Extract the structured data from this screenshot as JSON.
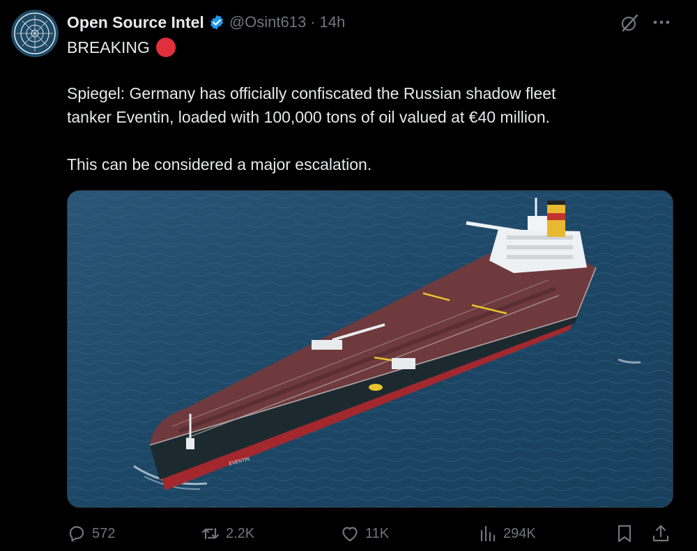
{
  "tweet": {
    "author_name": "Open Source Intel",
    "author_handle": "@Osint613",
    "separator": "·",
    "time": "14h",
    "breaking_label": "BREAKING",
    "body_line1": "Spiegel: Germany has officially confiscated the Russian shadow fleet",
    "body_line2": "tanker Eventin, loaded with 100,000 tons of oil valued at €40 million.",
    "body_line3": "This can be considered a major escalation.",
    "ship_name_on_hull": "EVENTIN"
  },
  "actions": {
    "replies": "572",
    "reposts": "2.2K",
    "likes": "11K",
    "views": "294K"
  },
  "colors": {
    "background": "#000000",
    "text_primary": "#e7e9ea",
    "text_secondary": "#71767b",
    "verified_blue": "#1d9bf0",
    "breaking_red": "#e0303c",
    "sea": "#1e4866",
    "deck": "#6e3a3e",
    "hull": "#1c2a30",
    "waterline": "#a3282e"
  },
  "icons": [
    "avatar-logo",
    "verified-badge-icon",
    "grok-icon",
    "more-icon",
    "reply-icon",
    "repost-icon",
    "like-icon",
    "views-icon",
    "bookmark-icon",
    "share-icon"
  ]
}
